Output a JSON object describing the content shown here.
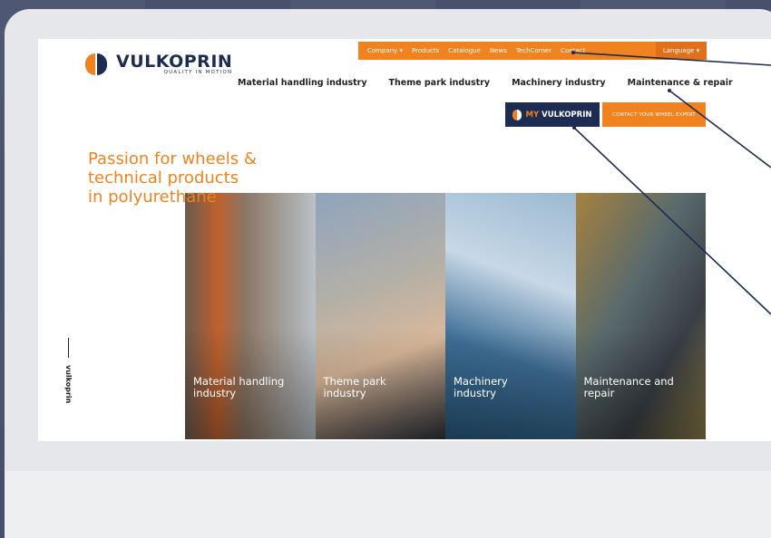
{
  "brand": {
    "name": "VULKOPRIN",
    "tagline": "QUALITY IN MOTION",
    "primary_color": "#f0831f",
    "navy_color": "#1c2c52"
  },
  "top_nav": {
    "items": [
      "Company",
      "Products",
      "Catalogue",
      "News",
      "TechCorner",
      "Contact"
    ],
    "language_label": "Language"
  },
  "main_nav": {
    "items": [
      "Material handling industry",
      "Theme park industry",
      "Machinery industry",
      "Maintenance & repair"
    ]
  },
  "buttons": {
    "my_prefix": "MY",
    "my_brand": "VULKOPRIN",
    "my_sub": "QUALITY IN MOTION",
    "contact": "CONTACT YOUR WHEEL EXPERT"
  },
  "hero": {
    "lines": [
      "Passion for wheels &",
      "technical products",
      "in polyurethane"
    ]
  },
  "side_label": "vulkoprin",
  "tiles": [
    {
      "caption": [
        "Material handling",
        "industry"
      ]
    },
    {
      "caption": [
        "Theme park",
        "industry"
      ]
    },
    {
      "caption": [
        "Machinery",
        "industry"
      ]
    },
    {
      "caption": [
        "Maintenance and",
        "repair"
      ]
    }
  ]
}
